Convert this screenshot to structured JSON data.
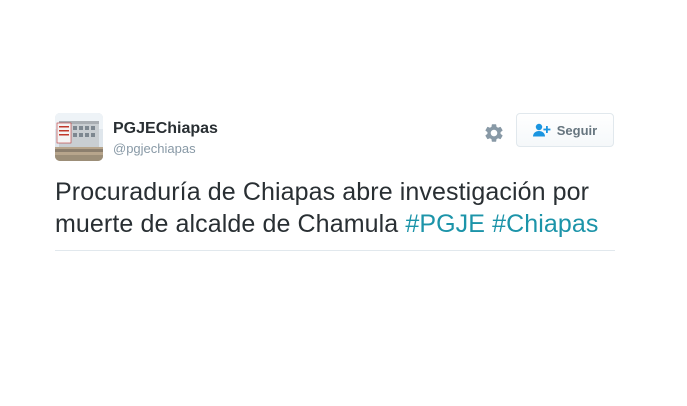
{
  "user": {
    "display_name": "PGJEChiapas",
    "screen_name": "@pgjechiapas",
    "avatar_icon": "building-photo"
  },
  "actions": {
    "settings_icon": "gear-icon",
    "follow_icon": "add-user-icon",
    "follow_label": "Seguir"
  },
  "tweet": {
    "text_line": "Procuraduría de Chiapas abre investigación por muerte de alcalde de Chamula",
    "hashtag_1": "#PGJE",
    "hashtag_2": "#Chiapas"
  },
  "colors": {
    "hashtag": "#1c94a9",
    "text": "#292f33",
    "muted": "#8899a6",
    "button_text": "#66757f"
  }
}
